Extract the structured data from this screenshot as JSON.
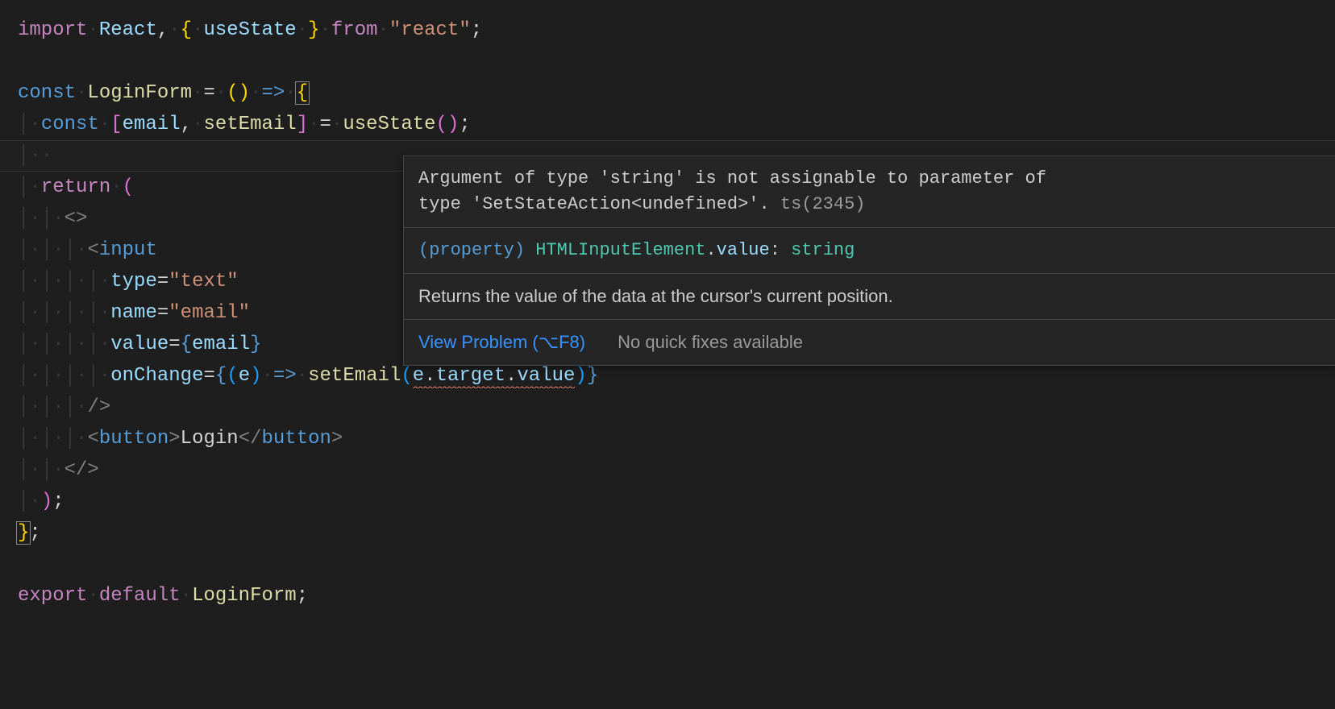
{
  "code": {
    "l1": {
      "import": "import",
      "space": "·",
      "react": "React",
      "comma": ",",
      "lb": "{",
      "use": "useState",
      "rb": "}",
      "from": "from",
      "str": "\"react\"",
      "semi": ";"
    },
    "l3": {
      "const": "const",
      "name": "LoginForm",
      "eq": "=",
      "lp": "(",
      "rp": ")",
      "arrow": "=>",
      "lb": "{"
    },
    "l4": {
      "const": "const",
      "lb": "[",
      "email": "email",
      "comma": ",",
      "set": "setEmail",
      "rb": "]",
      "eq": "=",
      "fn": "useState",
      "lp": "(",
      "rp": ")",
      "semi": ";"
    },
    "l6": {
      "ret": "return",
      "lp": "("
    },
    "l7": {
      "open": "<>"
    },
    "l8": {
      "tag": "input",
      "la": "<"
    },
    "l9": {
      "attr": "type",
      "eq": "=",
      "val": "\"text\""
    },
    "l10": {
      "attr": "name",
      "eq": "=",
      "val": "\"email\""
    },
    "l11": {
      "attr": "value",
      "eq": "=",
      "lb": "{",
      "v": "email",
      "rb": "}"
    },
    "l12": {
      "attr": "onChange",
      "eq": "=",
      "lb": "{",
      "lp": "(",
      "p": "e",
      "rp": ")",
      "arrow": "=>",
      "fn": "setEmail",
      "lp2": "(",
      "e": "e",
      "dot1": ".",
      "t": "target",
      "dot2": ".",
      "v": "value",
      "rp2": ")",
      "rb": "}"
    },
    "l13": {
      "close": "/>"
    },
    "l14": {
      "la": "<",
      "tag": "button",
      "ra": ">",
      "text": "Login",
      "lc": "</",
      "tag2": "button",
      "rc": ">"
    },
    "l15": {
      "close": "</>"
    },
    "l16": {
      "rp": ")",
      "semi": ";"
    },
    "l17": {
      "rb": "}",
      "semi": ";"
    },
    "l19": {
      "exp": "export",
      "def": "default",
      "name": "LoginForm",
      "semi": ";"
    }
  },
  "hover": {
    "err1": "Argument of type 'string' is not assignable to parameter of",
    "err2": "type 'SetStateAction<undefined>'.",
    "errcode": "ts(2345)",
    "sig_prop": "(property)",
    "sig_type": "HTMLInputElement",
    "sig_dot": ".",
    "sig_name": "value",
    "sig_colon": ":",
    "sig_rt": "string",
    "doc": "Returns the value of the data at the cursor's current position.",
    "link": "View Problem (⌥F8)",
    "nofix": "No quick fixes available"
  }
}
